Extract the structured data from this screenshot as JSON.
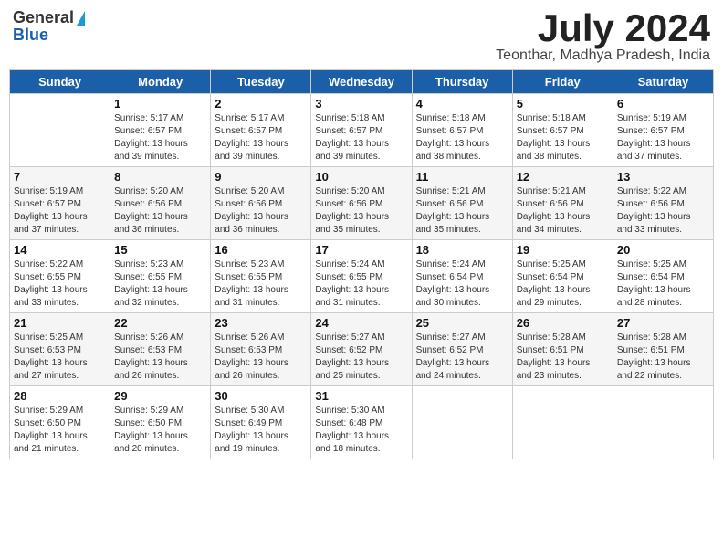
{
  "header": {
    "logo_line1": "General",
    "logo_line2": "Blue",
    "month": "July 2024",
    "location": "Teonthar, Madhya Pradesh, India"
  },
  "days_of_week": [
    "Sunday",
    "Monday",
    "Tuesday",
    "Wednesday",
    "Thursday",
    "Friday",
    "Saturday"
  ],
  "weeks": [
    [
      {
        "num": "",
        "details": ""
      },
      {
        "num": "1",
        "details": "Sunrise: 5:17 AM\nSunset: 6:57 PM\nDaylight: 13 hours\nand 39 minutes."
      },
      {
        "num": "2",
        "details": "Sunrise: 5:17 AM\nSunset: 6:57 PM\nDaylight: 13 hours\nand 39 minutes."
      },
      {
        "num": "3",
        "details": "Sunrise: 5:18 AM\nSunset: 6:57 PM\nDaylight: 13 hours\nand 39 minutes."
      },
      {
        "num": "4",
        "details": "Sunrise: 5:18 AM\nSunset: 6:57 PM\nDaylight: 13 hours\nand 38 minutes."
      },
      {
        "num": "5",
        "details": "Sunrise: 5:18 AM\nSunset: 6:57 PM\nDaylight: 13 hours\nand 38 minutes."
      },
      {
        "num": "6",
        "details": "Sunrise: 5:19 AM\nSunset: 6:57 PM\nDaylight: 13 hours\nand 37 minutes."
      }
    ],
    [
      {
        "num": "7",
        "details": "Sunrise: 5:19 AM\nSunset: 6:57 PM\nDaylight: 13 hours\nand 37 minutes."
      },
      {
        "num": "8",
        "details": "Sunrise: 5:20 AM\nSunset: 6:56 PM\nDaylight: 13 hours\nand 36 minutes."
      },
      {
        "num": "9",
        "details": "Sunrise: 5:20 AM\nSunset: 6:56 PM\nDaylight: 13 hours\nand 36 minutes."
      },
      {
        "num": "10",
        "details": "Sunrise: 5:20 AM\nSunset: 6:56 PM\nDaylight: 13 hours\nand 35 minutes."
      },
      {
        "num": "11",
        "details": "Sunrise: 5:21 AM\nSunset: 6:56 PM\nDaylight: 13 hours\nand 35 minutes."
      },
      {
        "num": "12",
        "details": "Sunrise: 5:21 AM\nSunset: 6:56 PM\nDaylight: 13 hours\nand 34 minutes."
      },
      {
        "num": "13",
        "details": "Sunrise: 5:22 AM\nSunset: 6:56 PM\nDaylight: 13 hours\nand 33 minutes."
      }
    ],
    [
      {
        "num": "14",
        "details": "Sunrise: 5:22 AM\nSunset: 6:55 PM\nDaylight: 13 hours\nand 33 minutes."
      },
      {
        "num": "15",
        "details": "Sunrise: 5:23 AM\nSunset: 6:55 PM\nDaylight: 13 hours\nand 32 minutes."
      },
      {
        "num": "16",
        "details": "Sunrise: 5:23 AM\nSunset: 6:55 PM\nDaylight: 13 hours\nand 31 minutes."
      },
      {
        "num": "17",
        "details": "Sunrise: 5:24 AM\nSunset: 6:55 PM\nDaylight: 13 hours\nand 31 minutes."
      },
      {
        "num": "18",
        "details": "Sunrise: 5:24 AM\nSunset: 6:54 PM\nDaylight: 13 hours\nand 30 minutes."
      },
      {
        "num": "19",
        "details": "Sunrise: 5:25 AM\nSunset: 6:54 PM\nDaylight: 13 hours\nand 29 minutes."
      },
      {
        "num": "20",
        "details": "Sunrise: 5:25 AM\nSunset: 6:54 PM\nDaylight: 13 hours\nand 28 minutes."
      }
    ],
    [
      {
        "num": "21",
        "details": "Sunrise: 5:25 AM\nSunset: 6:53 PM\nDaylight: 13 hours\nand 27 minutes."
      },
      {
        "num": "22",
        "details": "Sunrise: 5:26 AM\nSunset: 6:53 PM\nDaylight: 13 hours\nand 26 minutes."
      },
      {
        "num": "23",
        "details": "Sunrise: 5:26 AM\nSunset: 6:53 PM\nDaylight: 13 hours\nand 26 minutes."
      },
      {
        "num": "24",
        "details": "Sunrise: 5:27 AM\nSunset: 6:52 PM\nDaylight: 13 hours\nand 25 minutes."
      },
      {
        "num": "25",
        "details": "Sunrise: 5:27 AM\nSunset: 6:52 PM\nDaylight: 13 hours\nand 24 minutes."
      },
      {
        "num": "26",
        "details": "Sunrise: 5:28 AM\nSunset: 6:51 PM\nDaylight: 13 hours\nand 23 minutes."
      },
      {
        "num": "27",
        "details": "Sunrise: 5:28 AM\nSunset: 6:51 PM\nDaylight: 13 hours\nand 22 minutes."
      }
    ],
    [
      {
        "num": "28",
        "details": "Sunrise: 5:29 AM\nSunset: 6:50 PM\nDaylight: 13 hours\nand 21 minutes."
      },
      {
        "num": "29",
        "details": "Sunrise: 5:29 AM\nSunset: 6:50 PM\nDaylight: 13 hours\nand 20 minutes."
      },
      {
        "num": "30",
        "details": "Sunrise: 5:30 AM\nSunset: 6:49 PM\nDaylight: 13 hours\nand 19 minutes."
      },
      {
        "num": "31",
        "details": "Sunrise: 5:30 AM\nSunset: 6:48 PM\nDaylight: 13 hours\nand 18 minutes."
      },
      {
        "num": "",
        "details": ""
      },
      {
        "num": "",
        "details": ""
      },
      {
        "num": "",
        "details": ""
      }
    ]
  ]
}
